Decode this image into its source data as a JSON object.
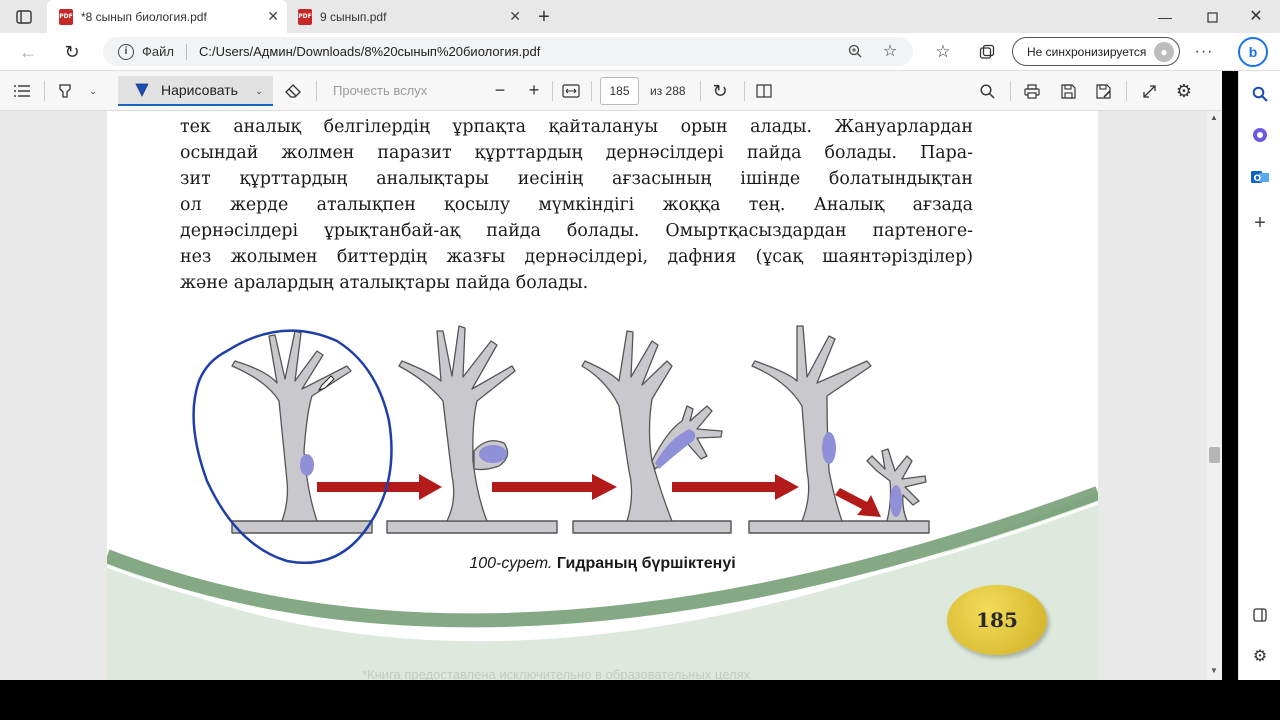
{
  "tabs": [
    {
      "title": "*8 сынып биология.pdf",
      "icon": "pdf-icon"
    },
    {
      "title": "9 сынып.pdf",
      "icon": "pdf-icon"
    }
  ],
  "address": {
    "scheme_label": "Файл",
    "url": "C:/Users/Админ/Downloads/8%20сынып%20биология.pdf"
  },
  "sync": {
    "label": "Не синхронизируется"
  },
  "toolbar": {
    "draw_label": "Нарисовать",
    "read_aloud": "Прочесть вслух",
    "page_current": "185",
    "page_total": "из 288"
  },
  "document": {
    "lines": [
      "тек аналық белгілердің ұрпақта қайталануы орын алады. Жануарлардан",
      "осындай жолмен паразит құрттардың дернәсілдері пайда болады. Пара-",
      "зит құрттардың аналықтары иесінің ағзасының ішінде болатындықтан",
      "ол жерде аталықпен қосылу мүмкіндігі жоққа тең. Аналық ағзада",
      "дернәсілдері ұрықтанбай-ақ пайда болады. Омыртқасыздардан партеноге-",
      "нез жолымен биттердің жазғы дернәсілдері, дафния (ұсақ шаянтәрізділер)",
      "және аралардың аталықтары пайда болады."
    ],
    "caption_italic": "100-сурет.",
    "caption_bold": "Гидраның бүршіктенуі",
    "page_number": "185",
    "watermark": "*Книга предоставлена исключительно в образовательных целях"
  },
  "colors": {
    "annotation": "#1e3fa8",
    "arrow": "#b71c1c",
    "hydra": "#c8c8cc",
    "bud": "#8e8ed8",
    "badge": "#e0c43c",
    "page_band": "#d8e8d8"
  }
}
